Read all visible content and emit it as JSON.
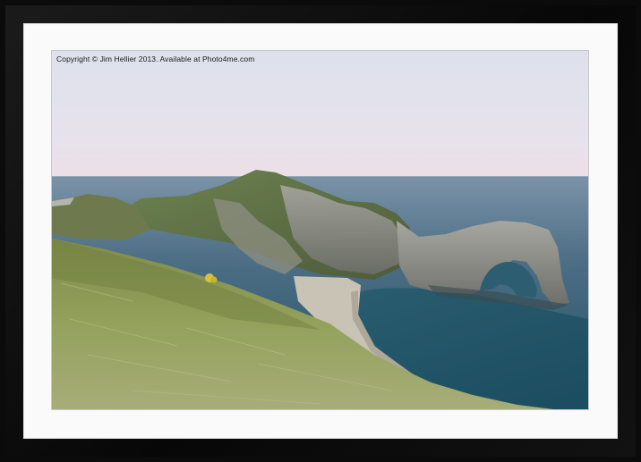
{
  "watermark": {
    "text": "Copyright © Jim Hellier 2013. Available at Photo4me.com"
  },
  "colors": {
    "frame": "#0b0b0b",
    "mount": "#fafafa",
    "sky_top": "#dcdfea",
    "sky_horizon": "#ece2ea",
    "sea_far": "#4f6f86",
    "sea_near": "#1e5566",
    "grass": "#8c9c55",
    "rock": "#8e8f88"
  }
}
